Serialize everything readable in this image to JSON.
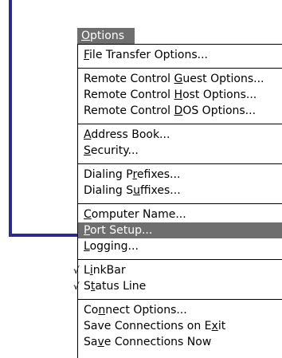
{
  "menu": {
    "title": "Options",
    "groups": [
      {
        "items": [
          {
            "before": "",
            "key": "F",
            "after": "ile Transfer Options...",
            "checked": false,
            "highlighted": false
          }
        ]
      },
      {
        "items": [
          {
            "before": "Remote Control ",
            "key": "G",
            "after": "uest Options...",
            "checked": false,
            "highlighted": false
          },
          {
            "before": "Remote Control ",
            "key": "H",
            "after": "ost Options...",
            "checked": false,
            "highlighted": false
          },
          {
            "before": "Remote Control ",
            "key": "D",
            "after": "OS Options...",
            "checked": false,
            "highlighted": false
          }
        ]
      },
      {
        "items": [
          {
            "before": "",
            "key": "A",
            "after": "ddress Book...",
            "checked": false,
            "highlighted": false
          },
          {
            "before": "",
            "key": "S",
            "after": "ecurity...",
            "checked": false,
            "highlighted": false
          }
        ]
      },
      {
        "items": [
          {
            "before": "Dialing P",
            "key": "r",
            "after": "efixes...",
            "checked": false,
            "highlighted": false
          },
          {
            "before": "Dialing S",
            "key": "u",
            "after": "ffixes...",
            "checked": false,
            "highlighted": false
          }
        ]
      },
      {
        "items": [
          {
            "before": "",
            "key": "C",
            "after": "omputer Name...",
            "checked": false,
            "highlighted": false
          },
          {
            "before": "",
            "key": "P",
            "after": "ort Setup...",
            "checked": false,
            "highlighted": true
          },
          {
            "before": "",
            "key": "L",
            "after": "ogging...",
            "checked": false,
            "highlighted": false
          }
        ]
      },
      {
        "items": [
          {
            "before": "L",
            "key": "i",
            "after": "nkBar",
            "checked": true,
            "highlighted": false
          },
          {
            "before": "S",
            "key": "t",
            "after": "atus Line",
            "checked": true,
            "highlighted": false
          }
        ]
      },
      {
        "items": [
          {
            "before": "Co",
            "key": "n",
            "after": "nect Options...",
            "checked": false,
            "highlighted": false
          },
          {
            "before": "Save Connections on E",
            "key": "x",
            "after": "it",
            "checked": false,
            "highlighted": false
          },
          {
            "before": "Sa",
            "key": "v",
            "after": "e Connections Now",
            "checked": false,
            "highlighted": false
          }
        ]
      }
    ],
    "check_glyph": "√"
  },
  "colors": {
    "callout": "#2c2c86",
    "highlight": "#6e6e6e"
  }
}
